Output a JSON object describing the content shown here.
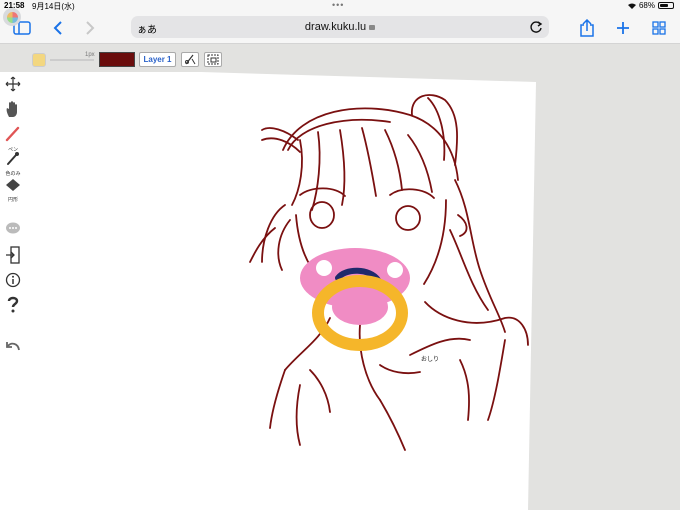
{
  "status_bar": {
    "time": "21:58",
    "date": "9月14日(水)",
    "dots": "•••",
    "battery": "68%",
    "battery_level": 0.68
  },
  "browser": {
    "aa_label": "ぁあ",
    "url": "draw.kuku.lu"
  },
  "app": {
    "brush_size": "1px",
    "current_color": "#6a0c0c",
    "layer_label": "Layer 1",
    "tools": {
      "pen_label": "ペン",
      "eyedropper_label": "色のみ",
      "shape_label": "円形"
    }
  },
  "canvas": {
    "annotation_text": "おしり",
    "line_color": "#7a1010",
    "pacifier_colors": {
      "shield": "#f08cc4",
      "ring": "#f5b62a",
      "knob": "#1f2a6b"
    }
  }
}
